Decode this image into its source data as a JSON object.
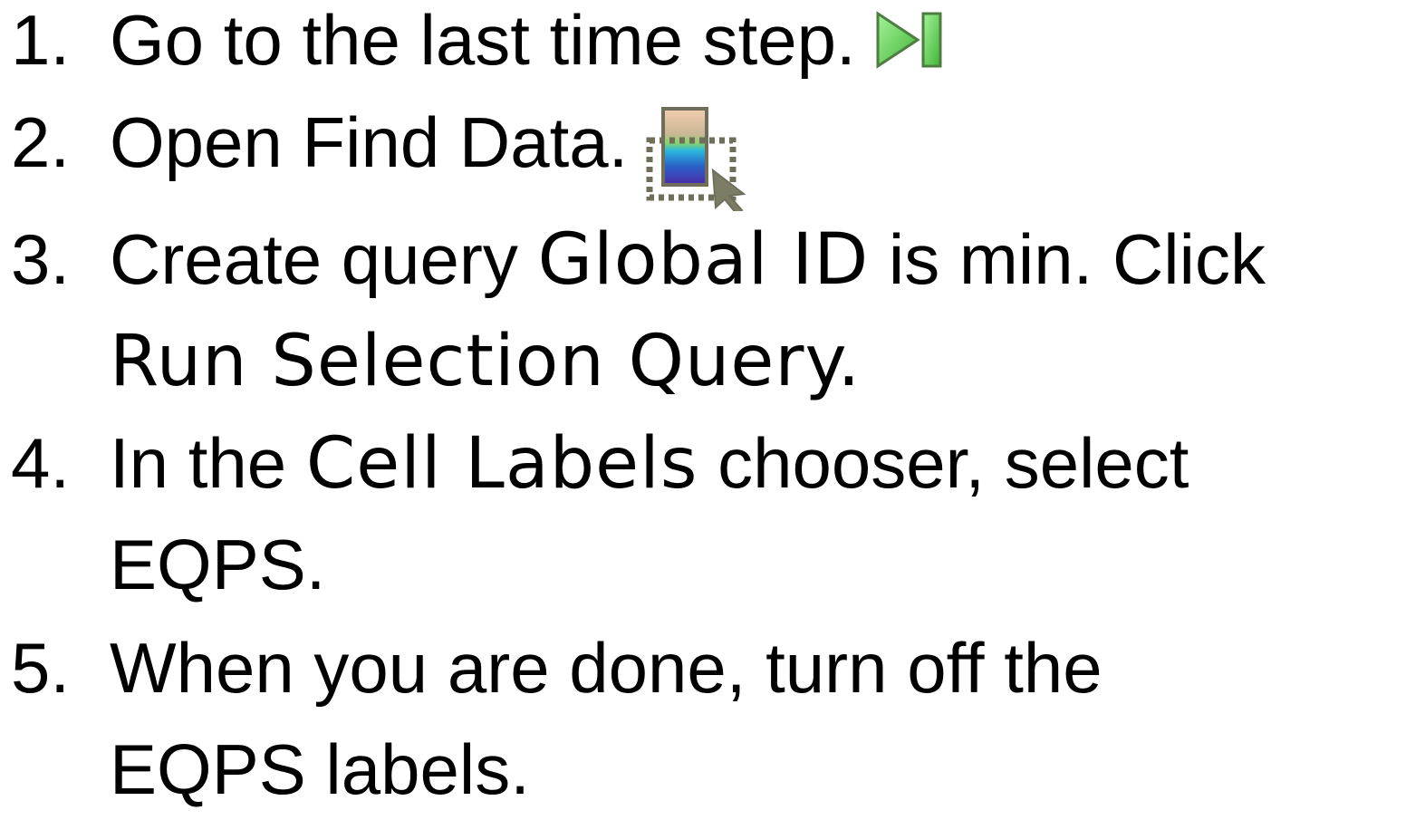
{
  "steps": [
    {
      "number": "1.",
      "lines": [
        "Go to the last time step."
      ],
      "icon": "last-time-step-icon"
    },
    {
      "number": "2.",
      "lines": [
        "Open Find Data."
      ],
      "icon": "find-data-icon"
    },
    {
      "number": "3.",
      "parts": {
        "before": "Create query ",
        "highlight": "Global ID",
        "after": " is min. Click"
      },
      "line2": "Run Selection Query."
    },
    {
      "number": "4.",
      "parts": {
        "before": "In the ",
        "highlight": "Cell Labels",
        "after": " chooser, select"
      },
      "line2": "EQPS."
    },
    {
      "number": "5.",
      "lines": [
        "When you are done, turn off the",
        "EQPS labels."
      ]
    }
  ],
  "colors": {
    "text": "#000000",
    "icon_green_light": "#78e070",
    "icon_green_dark": "#3a8a30",
    "icon_outline": "#6b6b55",
    "gradient_top": "#f6d8b4",
    "gradient_mid": "#37c6d6",
    "gradient_bottom": "#3a2fa8"
  }
}
